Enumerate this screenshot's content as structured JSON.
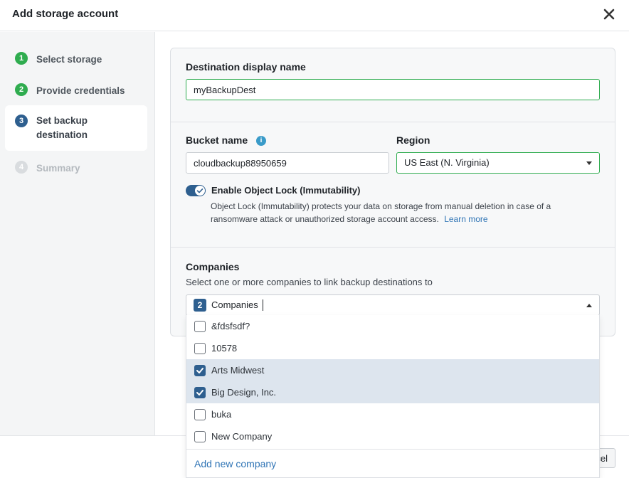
{
  "header": {
    "title": "Add storage account",
    "close_icon": "close-icon"
  },
  "steps": [
    {
      "number": "1",
      "label": "Select storage",
      "state": "done"
    },
    {
      "number": "2",
      "label": "Provide credentials",
      "state": "done"
    },
    {
      "number": "3",
      "label": "Set backup destination",
      "state": "active"
    },
    {
      "number": "4",
      "label": "Summary",
      "state": "disabled"
    }
  ],
  "destination": {
    "label": "Destination display name",
    "value": "myBackupDest"
  },
  "bucket": {
    "label": "Bucket name",
    "value": "cloudbackup88950659",
    "info_icon": "info-icon"
  },
  "region": {
    "label": "Region",
    "value": "US East (N. Virginia)"
  },
  "object_lock": {
    "label": "Enable Object Lock (Immutability)",
    "enabled": true,
    "description": "Object Lock (Immutability) protects your data on storage from manual deletion in case of a ransomware attack or unauthorized storage account access.",
    "learn_more": "Learn more"
  },
  "companies": {
    "label": "Companies",
    "subtitle": "Select one or more companies to link backup destinations to",
    "selected_count": "2",
    "field_text": "Companies",
    "options": [
      {
        "label": "&fdsfsdf?",
        "checked": false
      },
      {
        "label": "10578",
        "checked": false
      },
      {
        "label": "Arts Midwest",
        "checked": true
      },
      {
        "label": "Big Design, Inc.",
        "checked": true
      },
      {
        "label": "buka",
        "checked": false
      },
      {
        "label": "New Company",
        "checked": false
      }
    ],
    "add_new": "Add new company"
  },
  "footer": {
    "cancel_label": "Cancel"
  },
  "colors": {
    "accent": "#2e5f8f",
    "success": "#2fac4f",
    "link": "#2f74b5"
  }
}
